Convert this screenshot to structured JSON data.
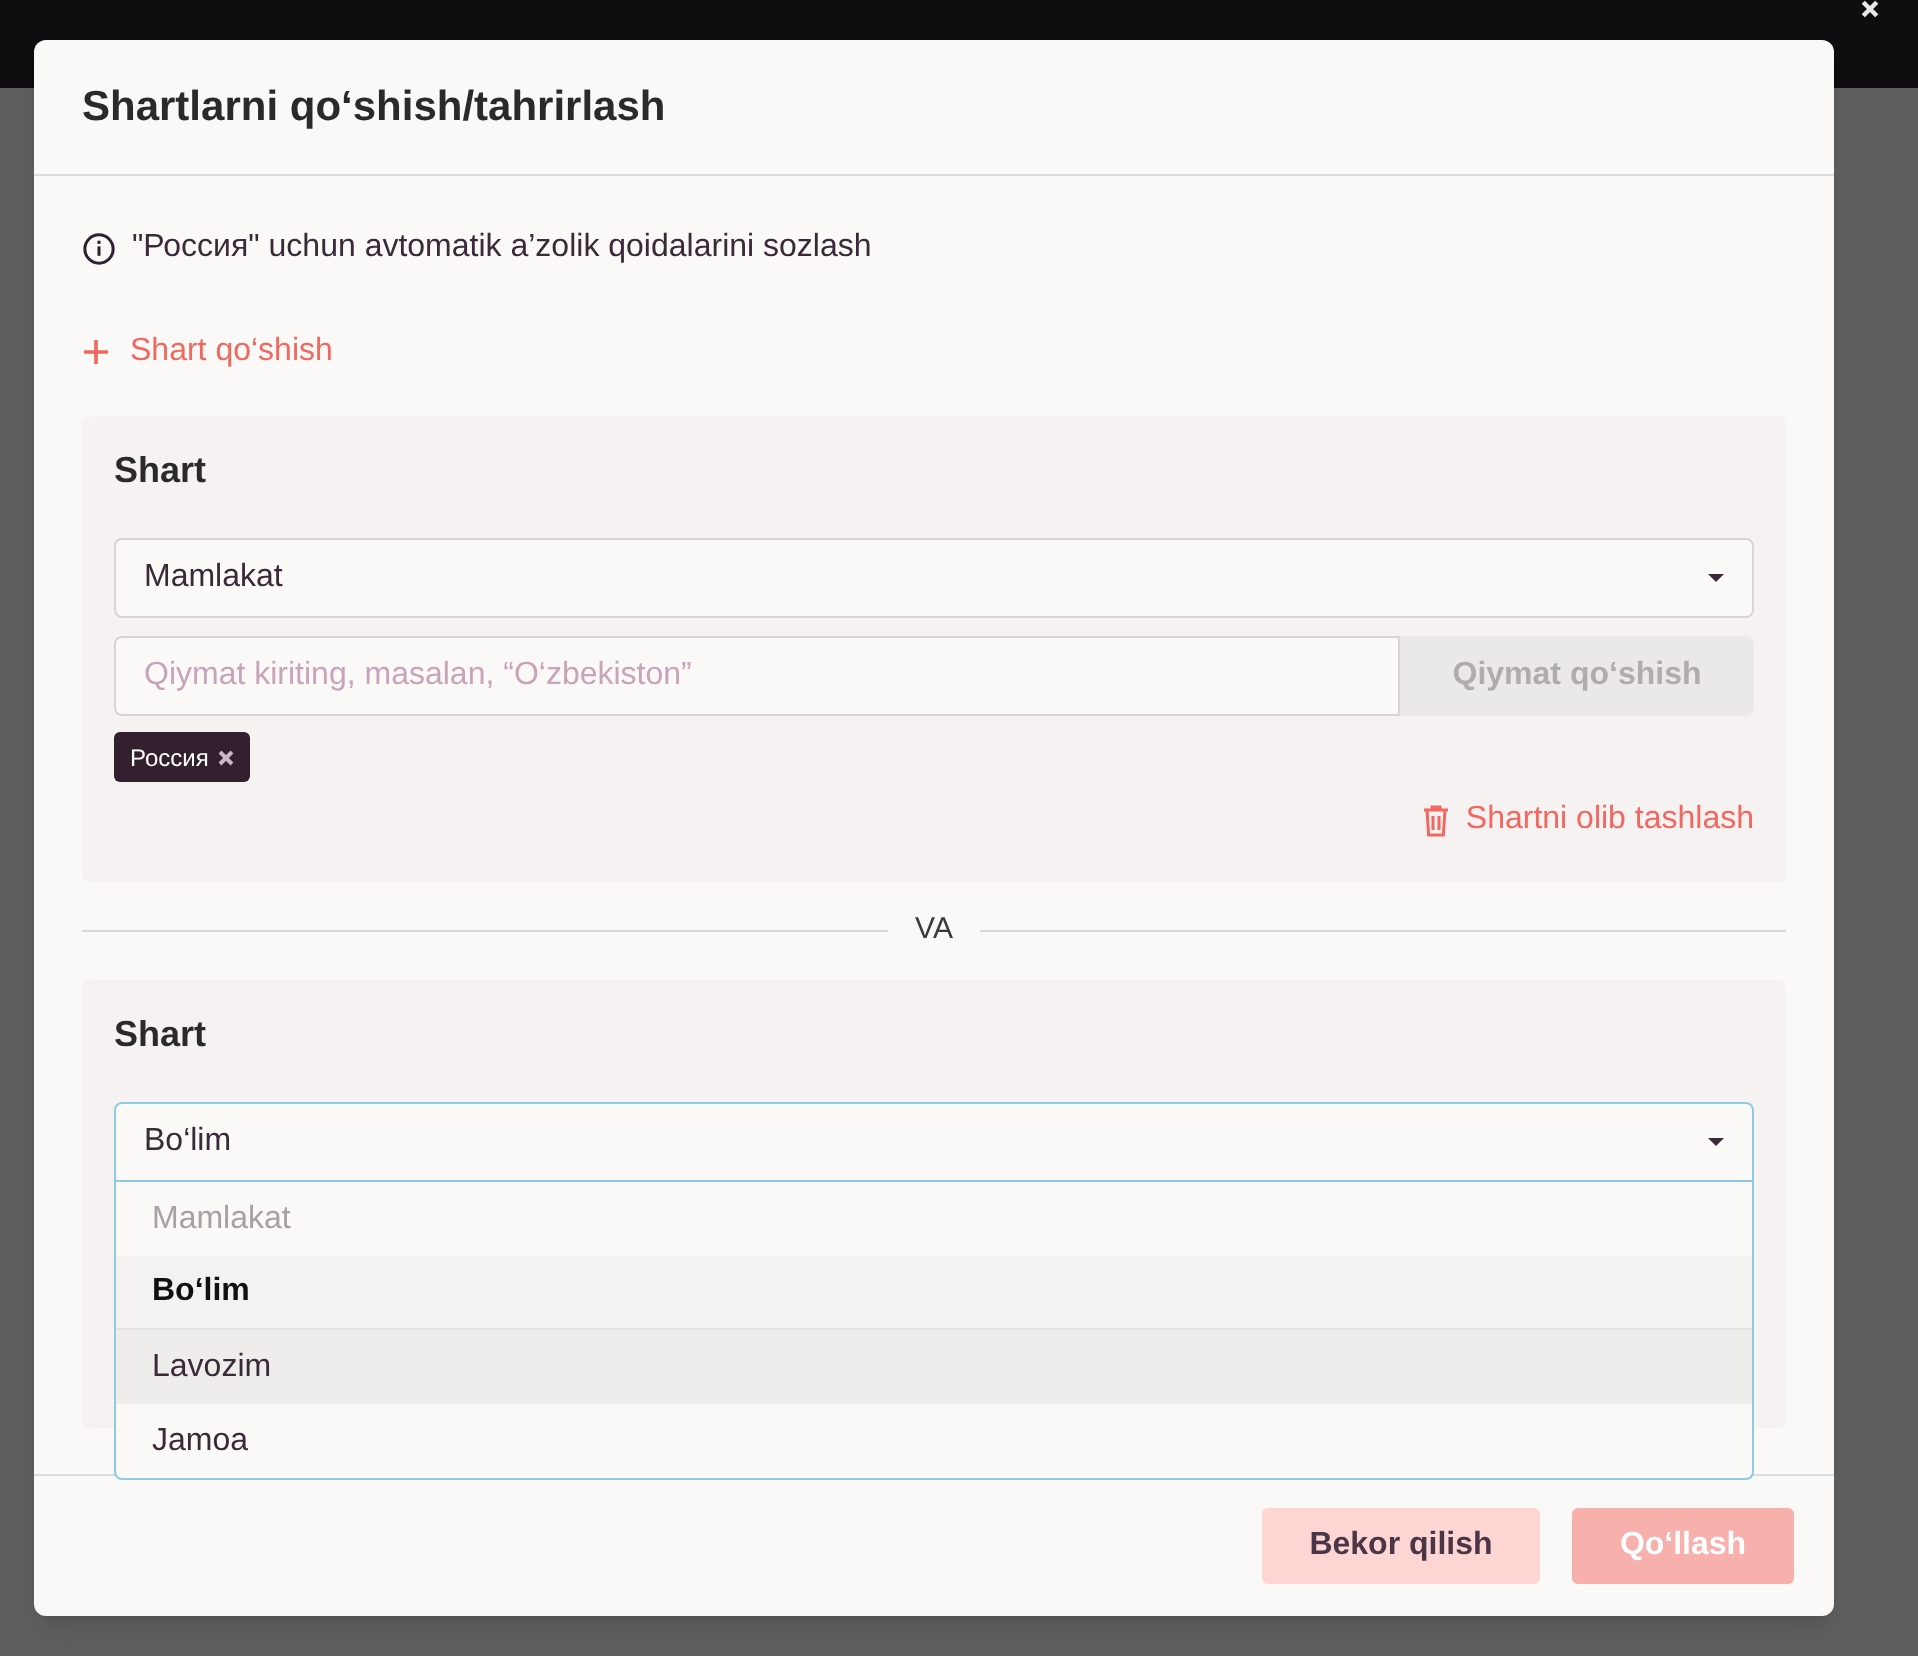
{
  "modal": {
    "title": "Shartlarni qo‘shish/tahrirlash"
  },
  "info": "\"Россия\" uchun avtomatik a’zolik qoidalarini sozlash",
  "add_condition": "Shart qo‘shish",
  "conditions": [
    {
      "title": "Shart",
      "select": {
        "value": "Mamlakat",
        "open": false
      },
      "value_input": {
        "placeholder": "Qiymat kiriting, masalan, “O‘zbekiston”"
      },
      "add_value_button": {
        "label": "Qiymat qo‘shish",
        "disabled": true
      },
      "tags": [
        "Россия"
      ],
      "remove": "Shartni olib tashlash"
    },
    {
      "title": "Shart",
      "select": {
        "value": "Bo‘lim",
        "open": true,
        "options": [
          {
            "label": "Mamlakat",
            "disabled": true,
            "selected": false,
            "highlighted": false
          },
          {
            "label": "Bo‘lim",
            "disabled": false,
            "selected": true,
            "highlighted": false
          },
          {
            "label": "Lavozim",
            "disabled": false,
            "selected": false,
            "highlighted": true
          },
          {
            "label": "Jamoa",
            "disabled": false,
            "selected": false,
            "highlighted": false
          }
        ]
      }
    }
  ],
  "separator": "VA",
  "buttons": [
    {
      "label": "Bekor qilish",
      "kind": "secondary"
    },
    {
      "label": "Qo‘llash",
      "kind": "primary"
    }
  ]
}
